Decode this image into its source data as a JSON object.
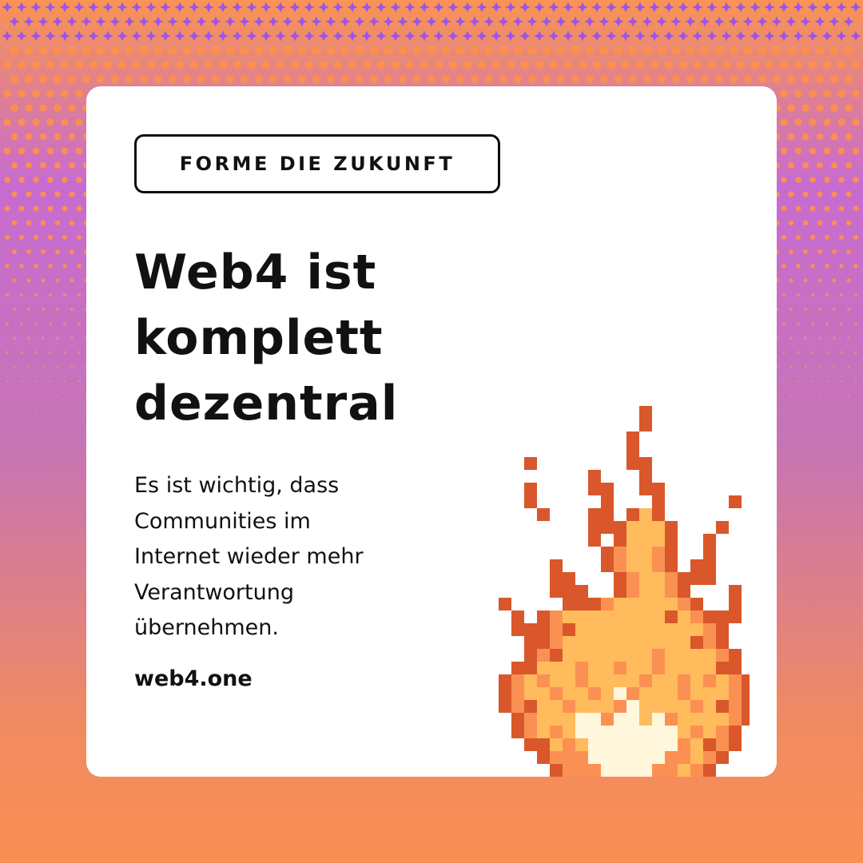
{
  "card": {
    "tag": "FORME DIE ZUKUNFT",
    "headline": [
      "Web4 ist",
      "komplett",
      "dezentral"
    ],
    "body_lines": [
      "Es ist wichtig, dass",
      "Communities im",
      "Internet wieder mehr",
      "Verantwortung",
      "übernehmen."
    ],
    "url": "web4.one"
  },
  "colors": {
    "orange": "#fb8f52",
    "purple": "#9c55e8",
    "ink": "#111111",
    "flame_dark": "#d9572a",
    "flame_mid": "#fa9153",
    "flame_light": "#ffbb5c",
    "flame_core": "#fff6dc"
  },
  "decoration": {
    "background_pattern": "pixel-halftone-dots",
    "illustration": "pixel-flame-icon"
  }
}
